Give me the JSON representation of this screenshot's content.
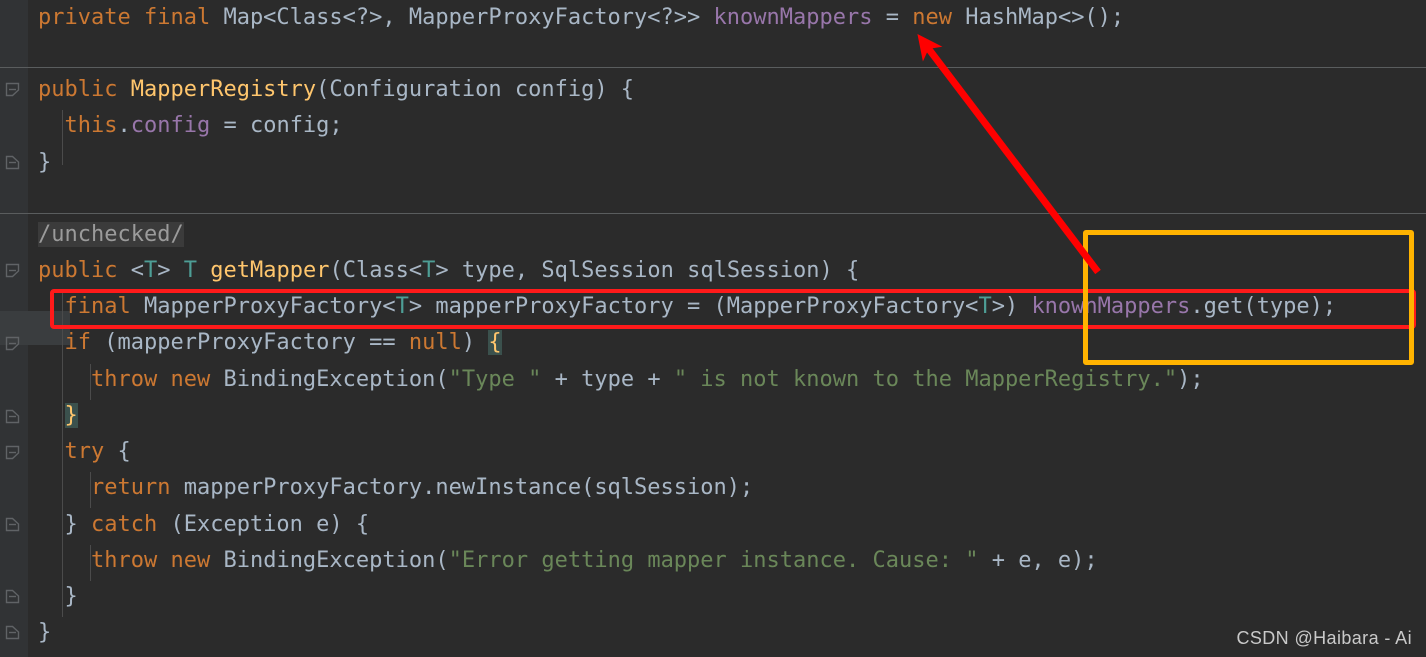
{
  "editor": {
    "theme_name": "darcula",
    "background": "#2b2b2b",
    "gutter_background": "#313335",
    "default_text_color": "#a9b7c6",
    "keyword_color": "#cc7832",
    "field_color": "#9876aa",
    "method_color": "#ffc66d",
    "string_color": "#6a8759",
    "type_param_color": "#4e9e96",
    "comment_color": "#9b9b9b"
  },
  "code_lines": [
    {
      "id": "line-field-declaration",
      "tokens": [
        {
          "t": "private",
          "c": "kw"
        },
        {
          "t": " ",
          "c": "plain"
        },
        {
          "t": "final",
          "c": "kw"
        },
        {
          "t": " Map<Class<?>, MapperProxyFactory<?>> ",
          "c": "plain"
        },
        {
          "t": "knownMappers",
          "c": "fld"
        },
        {
          "t": " = ",
          "c": "plain"
        },
        {
          "t": "new",
          "c": "kw"
        },
        {
          "t": " HashMap<>();",
          "c": "plain"
        }
      ]
    },
    {
      "id": "line-constructor-signature",
      "tokens": [
        {
          "t": "public",
          "c": "kw"
        },
        {
          "t": " ",
          "c": "plain"
        },
        {
          "t": "MapperRegistry",
          "c": "mth"
        },
        {
          "t": "(Configuration config) {",
          "c": "plain"
        }
      ]
    },
    {
      "id": "line-this-config",
      "tokens": [
        {
          "t": "  ",
          "c": "plain"
        },
        {
          "t": "this",
          "c": "kw"
        },
        {
          "t": ".",
          "c": "plain"
        },
        {
          "t": "config",
          "c": "fld"
        },
        {
          "t": " = config;",
          "c": "plain"
        }
      ]
    },
    {
      "id": "line-constructor-close",
      "tokens": [
        {
          "t": "}",
          "c": "plain"
        }
      ]
    },
    {
      "id": "line-unchecked-comment",
      "tokens": [
        {
          "t": "/unchecked/",
          "c": "cmt cmt-bg"
        }
      ]
    },
    {
      "id": "line-getmapper-signature",
      "tokens": [
        {
          "t": "public",
          "c": "kw"
        },
        {
          "t": " <",
          "c": "plain"
        },
        {
          "t": "T",
          "c": "typ"
        },
        {
          "t": "> ",
          "c": "plain"
        },
        {
          "t": "T",
          "c": "typ"
        },
        {
          "t": " ",
          "c": "plain"
        },
        {
          "t": "getMapper",
          "c": "mth"
        },
        {
          "t": "(Class<",
          "c": "plain"
        },
        {
          "t": "T",
          "c": "typ"
        },
        {
          "t": "> type, SqlSession sqlSession) {",
          "c": "plain"
        }
      ]
    },
    {
      "id": "line-mapperproxyfactory-lookup",
      "tokens": [
        {
          "t": "  ",
          "c": "plain"
        },
        {
          "t": "final",
          "c": "kw"
        },
        {
          "t": " MapperProxyFactory<",
          "c": "plain"
        },
        {
          "t": "T",
          "c": "typ"
        },
        {
          "t": "> mapperProxyFactory = (MapperProxyFactory<",
          "c": "plain"
        },
        {
          "t": "T",
          "c": "typ"
        },
        {
          "t": ">) ",
          "c": "plain"
        },
        {
          "t": "knownMappers",
          "c": "fld"
        },
        {
          "t": ".get(type);",
          "c": "plain"
        }
      ]
    },
    {
      "id": "line-null-check",
      "tokens": [
        {
          "t": "  ",
          "c": "plain"
        },
        {
          "t": "if",
          "c": "kw"
        },
        {
          "t": " (mapperProxyFactory == ",
          "c": "plain"
        },
        {
          "t": "null",
          "c": "kw"
        },
        {
          "t": ") ",
          "c": "plain"
        },
        {
          "t": "{",
          "c": "brace-hl"
        }
      ]
    },
    {
      "id": "line-throw-type-not-known",
      "tokens": [
        {
          "t": "    ",
          "c": "plain"
        },
        {
          "t": "throw",
          "c": "kw"
        },
        {
          "t": " ",
          "c": "plain"
        },
        {
          "t": "new",
          "c": "kw"
        },
        {
          "t": " BindingException(",
          "c": "plain"
        },
        {
          "t": "\"Type \"",
          "c": "str"
        },
        {
          "t": " + type + ",
          "c": "plain"
        },
        {
          "t": "\" is not known to the MapperRegistry.\"",
          "c": "str"
        },
        {
          "t": ");",
          "c": "plain"
        }
      ]
    },
    {
      "id": "line-nullcheck-close",
      "tokens": [
        {
          "t": "  ",
          "c": "plain"
        },
        {
          "t": "}",
          "c": "brace-hl"
        }
      ]
    },
    {
      "id": "line-try-open",
      "tokens": [
        {
          "t": "  ",
          "c": "plain"
        },
        {
          "t": "try",
          "c": "kw"
        },
        {
          "t": " {",
          "c": "plain"
        }
      ]
    },
    {
      "id": "line-return-newinstance",
      "tokens": [
        {
          "t": "    ",
          "c": "plain"
        },
        {
          "t": "return",
          "c": "kw"
        },
        {
          "t": " mapperProxyFactory.newInstance(sqlSession);",
          "c": "plain"
        }
      ]
    },
    {
      "id": "line-catch-exception",
      "tokens": [
        {
          "t": "  } ",
          "c": "plain"
        },
        {
          "t": "catch",
          "c": "kw"
        },
        {
          "t": " (Exception e) {",
          "c": "plain"
        }
      ]
    },
    {
      "id": "line-throw-error-getting",
      "tokens": [
        {
          "t": "    ",
          "c": "plain"
        },
        {
          "t": "throw",
          "c": "kw"
        },
        {
          "t": " ",
          "c": "plain"
        },
        {
          "t": "new",
          "c": "kw"
        },
        {
          "t": " BindingException(",
          "c": "plain"
        },
        {
          "t": "\"Error getting mapper instance. Cause: \"",
          "c": "str"
        },
        {
          "t": " + e, e);",
          "c": "plain"
        }
      ]
    },
    {
      "id": "line-catch-close",
      "tokens": [
        {
          "t": "  }",
          "c": "plain"
        }
      ]
    },
    {
      "id": "line-method-close",
      "tokens": [
        {
          "t": "}",
          "c": "plain"
        }
      ]
    }
  ],
  "annotations": {
    "red_box": {
      "label": "red-highlight-rectangle",
      "color": "#ff1a1a",
      "target_line": "line-mapperproxyfactory-lookup"
    },
    "orange_box": {
      "label": "orange-highlight-rectangle",
      "color": "#ffb300",
      "target_text": "knownMappers.get(type);"
    },
    "arrow": {
      "label": "red-pointer-arrow",
      "color": "#ff0000",
      "from_text": "knownMappers.get(type);",
      "to_text": "knownMappers"
    }
  },
  "watermark": {
    "text": "CSDN @Haibara - Ai"
  }
}
